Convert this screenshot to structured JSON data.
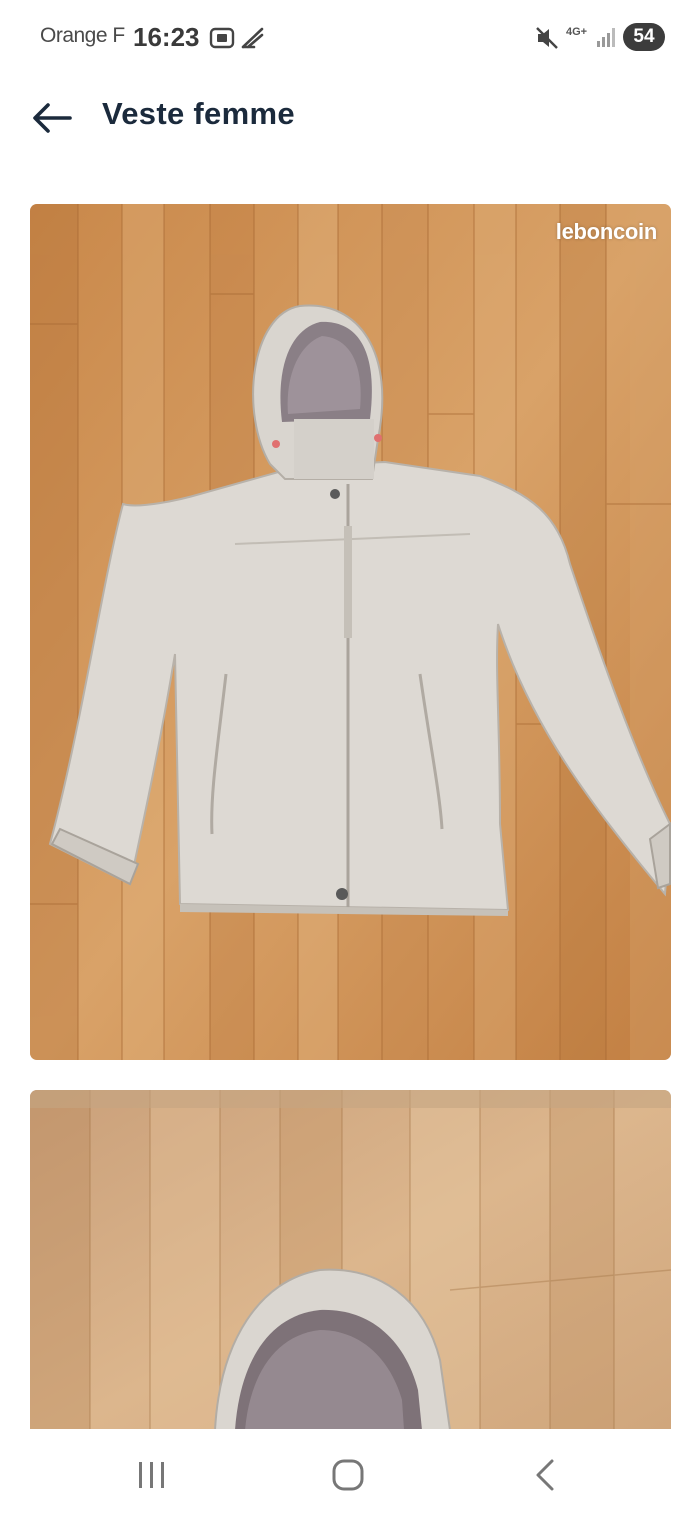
{
  "status_bar": {
    "carrier": "Orange F",
    "time": "16:23",
    "network": "4G+",
    "battery": "54"
  },
  "header": {
    "title": "Veste femme"
  },
  "photos": [
    {
      "watermark": "leboncoin"
    },
    {}
  ],
  "icons": {
    "back": "back-arrow-icon",
    "screenshot": "screenshot-icon",
    "bird": "bird-icon",
    "mute": "mute-icon",
    "signal": "signal-icon",
    "recents": "recents-icon",
    "home": "home-icon",
    "nav_back": "chevron-left-icon"
  }
}
